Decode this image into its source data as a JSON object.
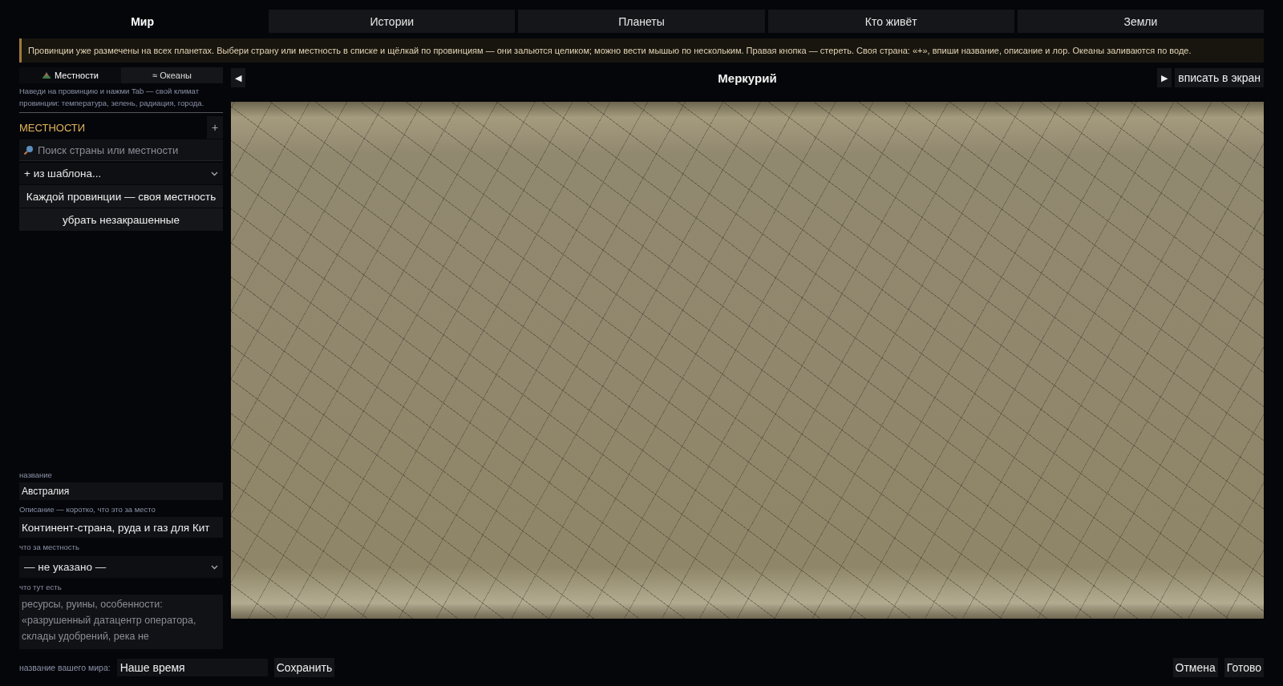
{
  "tabs": [
    {
      "label": "Мир",
      "selected": true
    },
    {
      "label": "Истории",
      "selected": false
    },
    {
      "label": "Планеты",
      "selected": false
    },
    {
      "label": "Кто живёт",
      "selected": false
    },
    {
      "label": "Земли",
      "selected": false
    }
  ],
  "banner": "Провинции уже размечены на всех планетах. Выбери страну или местность в списке и щёлкай по провинциям — они зальются целиком; можно вести мышью по нескольким. Правая кнопка — стереть. Своя страна: «+», впиши название, описание и лор. Океаны заливаются по воде.",
  "sidebar": {
    "mode_tabs": [
      {
        "label": "Местности",
        "kind": "land",
        "selected": true
      },
      {
        "label": "≈ Океаны",
        "kind": "plain",
        "selected": false
      }
    ],
    "hint": "Наведи на провинцию и нажми Tab — свой климат провинции: температура, зелень, радиация, города.",
    "section_title": "МЕСТНОСТИ",
    "add_label": "+",
    "search": {
      "placeholder": "Поиск страны или местности"
    },
    "template_select": "+ из шаблона...",
    "actions": [
      "Каждой провинции — своя местность",
      "убрать незакрашенные"
    ],
    "form": {
      "name_label": "название",
      "name_value": "Австралия",
      "description_label": "Описание — коротко, что это за место",
      "description_value": "Континент-страна, руда и газ для Кит",
      "type_label": "что за местность",
      "type_value": "— не указано —",
      "contents_label": "что тут есть",
      "contents_placeholder": "ресурсы, руины, особенности: «разрушенный датацентр оператора, склады удобрений, река не"
    }
  },
  "map": {
    "prev": "◀",
    "title": "Меркурий",
    "next": "▶",
    "fit": "вписать в экран"
  },
  "footer": {
    "world_label": "название вашего мира:",
    "world_value": "Наше время",
    "save": "Сохранить",
    "cancel": "Отмена",
    "done": "Готово"
  }
}
